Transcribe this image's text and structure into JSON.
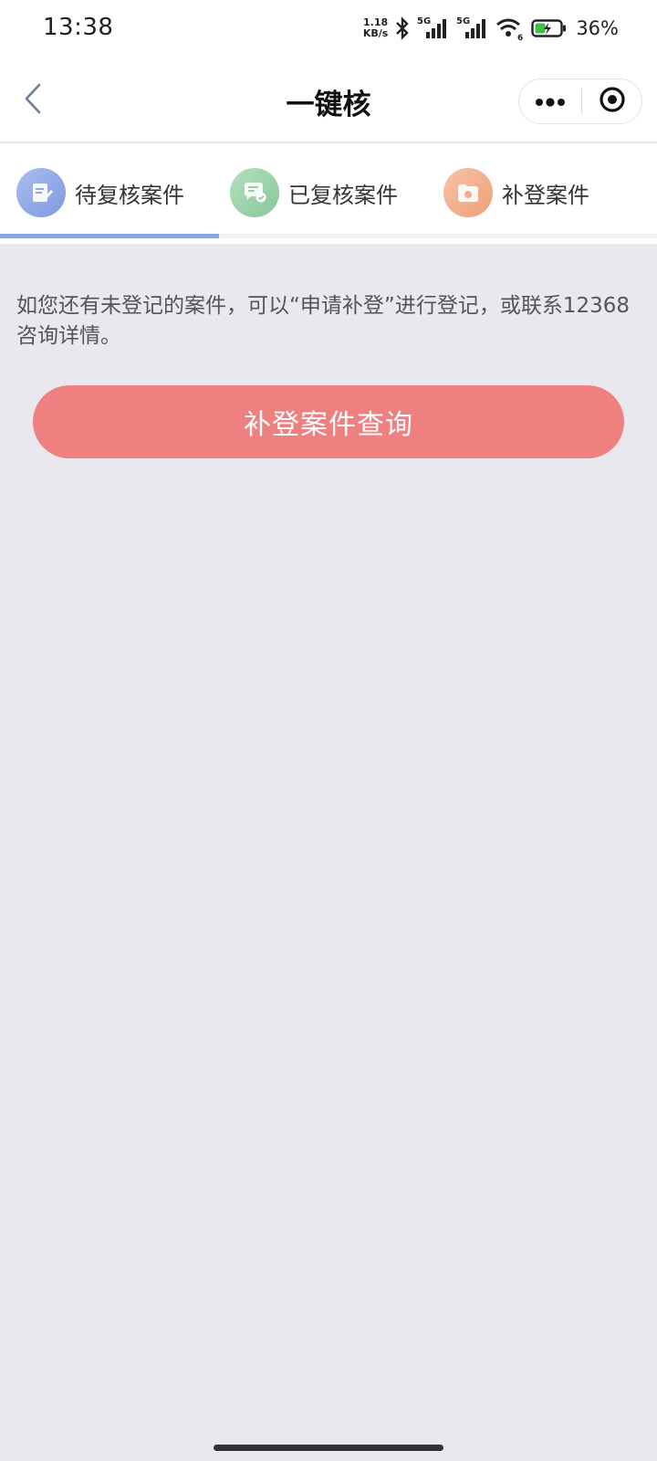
{
  "status_bar": {
    "time": "13:38",
    "net_speed_value": "1.18",
    "net_speed_unit": "KB/s",
    "signal1_label": "5G",
    "signal2_label": "5G",
    "wifi_sub": "6",
    "battery_percent": "36%",
    "icons": [
      "bluetooth-icon",
      "signal-icon",
      "wifi-icon",
      "battery-icon"
    ]
  },
  "nav": {
    "title": "一键核",
    "back_icon": "chevron-left-icon",
    "more_icon": "more-dots-icon",
    "close_icon": "target-close-icon"
  },
  "tabs": [
    {
      "label": "待复核案件",
      "icon": "notebook-edit-icon",
      "color": "#8ea8e6",
      "active": true
    },
    {
      "label": "已复核案件",
      "icon": "chat-check-icon",
      "color": "#92cfa3",
      "active": false
    },
    {
      "label": "补登案件",
      "icon": "folder-icon",
      "color": "#f2ad8a",
      "active": false
    }
  ],
  "main": {
    "notice_text": "如您还有未登记的案件，可以“申请补登”进行登记，或联系12368咨询详情。",
    "query_button_label": "补登案件查询"
  },
  "colors": {
    "background": "#e9e8ee",
    "primary_button": "#ee8180",
    "tab_indicator": "#8ca6de"
  }
}
